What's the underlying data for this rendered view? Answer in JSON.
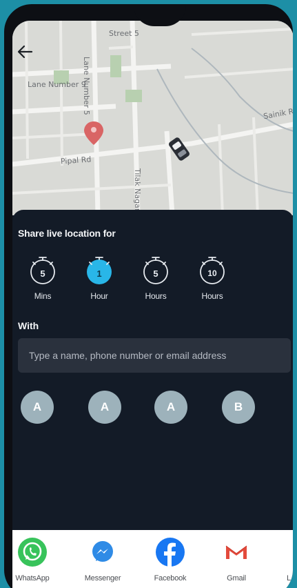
{
  "map": {
    "street_labels": [
      "Lane Number 9",
      "Pipal Rd",
      "Lane Number 5",
      "Street 5",
      "Sainik Rd",
      "Tilak Nagar Rd"
    ]
  },
  "icons": {
    "back": "back-arrow-icon",
    "timer": "stopwatch-icon",
    "pin": "map-pin-icon",
    "car": "car-icon"
  },
  "share_live": {
    "title": "Share live location for",
    "options": [
      {
        "value": "5",
        "unit": "Mins",
        "selected": false
      },
      {
        "value": "1",
        "unit": "Hour",
        "selected": true
      },
      {
        "value": "5",
        "unit": "Hours",
        "selected": false
      },
      {
        "value": "10",
        "unit": "Hours",
        "selected": false
      }
    ]
  },
  "with": {
    "label": "With",
    "placeholder": "Type a name, phone number or email address"
  },
  "contacts": [
    "A",
    "A",
    "A",
    "B"
  ],
  "share_apps": [
    {
      "name": "WhatsApp",
      "icon": "whatsapp-icon"
    },
    {
      "name": "Messenger",
      "icon": "messenger-icon"
    },
    {
      "name": "Facebook",
      "icon": "facebook-icon"
    },
    {
      "name": "Gmail",
      "icon": "gmail-icon"
    }
  ],
  "colors": {
    "accent": "#29b6e8",
    "sheet_bg": "#131b27",
    "contact_bg": "#9db2bb",
    "page_bg": "#1d8fa6"
  }
}
